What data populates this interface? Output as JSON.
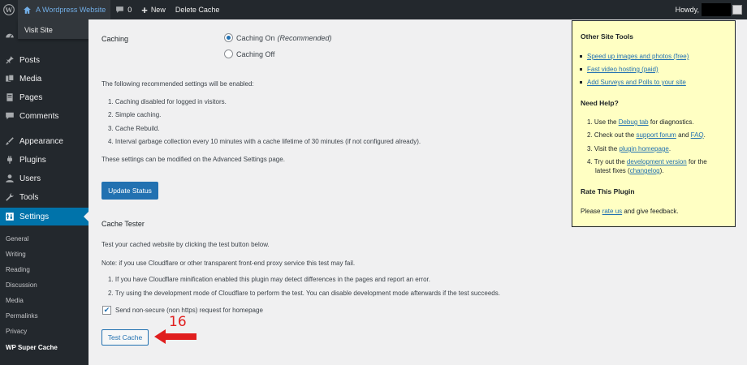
{
  "adminbar": {
    "site_name": "A Wordpress Website",
    "comments_count": "0",
    "new_label": "New",
    "delete_cache_label": "Delete Cache",
    "howdy_label": "Howdy,",
    "visit_site_label": "Visit Site"
  },
  "sidebar": {
    "items": [
      {
        "label": "Posts",
        "icon": "pin-icon"
      },
      {
        "label": "Media",
        "icon": "media-icon"
      },
      {
        "label": "Pages",
        "icon": "page-icon"
      },
      {
        "label": "Comments",
        "icon": "comment-icon"
      },
      {
        "label": "Appearance",
        "icon": "brush-icon"
      },
      {
        "label": "Plugins",
        "icon": "plug-icon"
      },
      {
        "label": "Users",
        "icon": "user-icon"
      },
      {
        "label": "Tools",
        "icon": "wrench-icon"
      },
      {
        "label": "Settings",
        "icon": "settings-icon"
      }
    ],
    "submenu": [
      "General",
      "Writing",
      "Reading",
      "Discussion",
      "Media",
      "Permalinks",
      "Privacy",
      "WP Super Cache"
    ]
  },
  "main": {
    "caching_label": "Caching",
    "caching_on": "Caching On",
    "caching_on_note": "(Recommended)",
    "caching_off": "Caching Off",
    "recommended_intro": "The following recommended settings will be enabled:",
    "recommended_items": [
      "1. Caching disabled for logged in visitors.",
      "2. Simple caching.",
      "3. Cache Rebuild.",
      "4. Interval garbage collection every 10 minutes with a cache lifetime of 30 minutes (if not configured already)."
    ],
    "modify_note": "These settings can be modified on the Advanced Settings page.",
    "update_button": "Update Status",
    "cache_tester_title": "Cache Tester",
    "tester_intro": "Test your cached website by clicking the test button below.",
    "cloudflare_note": "Note: if you use Cloudflare or other transparent front-end proxy service this test may fail.",
    "cloudflare_items": [
      "1. If you have Cloudflare minification enabled this plugin may detect differences in the pages and report an error.",
      "2. Try using the development mode of Cloudflare to perform the test. You can disable development mode afterwards if the test succeeds."
    ],
    "nonsecure_label": "Send non-secure (non https) request for homepage",
    "test_button": "Test Cache"
  },
  "panel": {
    "other_tools_title": "Other Site Tools",
    "other_tools_links": [
      "Speed up images and photos (free)",
      "Fast video hosting (paid)",
      "Add Surveys and Polls to your site"
    ],
    "need_help_title": "Need Help?",
    "help_1_pre": "1. Use the ",
    "help_1_link": "Debug tab",
    "help_1_post": " for diagnostics.",
    "help_2_pre": "2. Check out the ",
    "help_2_link": "support forum",
    "help_2_mid": " and ",
    "help_2_link2": "FAQ",
    "help_2_post": ".",
    "help_3_pre": "3. Visit the ",
    "help_3_link": "plugin homepage",
    "help_3_post": ".",
    "help_4_pre": "4. Try out the ",
    "help_4_link": "development version",
    "help_4_post": " for the",
    "help_4_line2_pre": "latest fixes (",
    "help_4_line2_link": "changelog",
    "help_4_line2_post": ").",
    "rate_title": "Rate This Plugin",
    "rate_pre": "Please ",
    "rate_link": "rate us",
    "rate_post": " and give feedback."
  },
  "annotation": {
    "step_number": "16"
  },
  "colors": {
    "adminbar_bg": "#23282d",
    "accent": "#0073aa",
    "panel_bg": "#ffffc3",
    "annotation_red": "#e01e1e"
  }
}
